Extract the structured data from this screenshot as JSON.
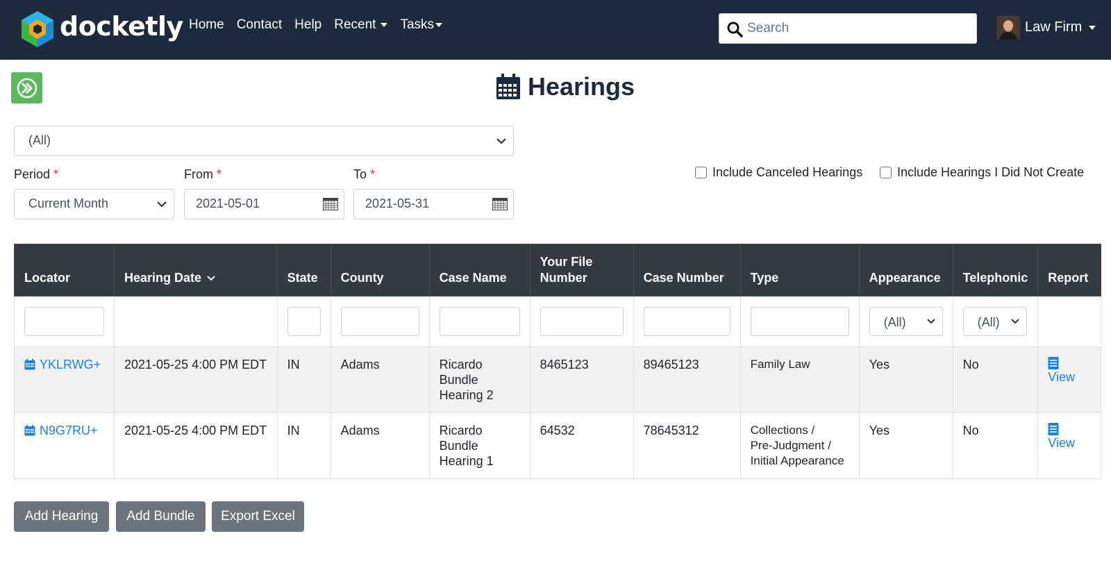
{
  "nav": {
    "brand": "docketly",
    "links": [
      "Home",
      "Contact",
      "Help",
      "Recent",
      "Tasks"
    ],
    "search_placeholder": "Search",
    "user": "Law Firm"
  },
  "page": {
    "title": "Hearings"
  },
  "filters": {
    "scope": "(All)",
    "period_label": "Period",
    "period_value": "Current Month",
    "from_label": "From",
    "from_value": "2021-05-01",
    "to_label": "To",
    "to_value": "2021-05-31",
    "required_mark": "*",
    "include_canceled": "Include Canceled Hearings",
    "include_not_created": "Include Hearings I Did Not Create"
  },
  "table": {
    "headers": [
      "Locator",
      "Hearing Date",
      "State",
      "County",
      "Case Name",
      "Your File Number",
      "Case Number",
      "Type",
      "Appearance",
      "Telephonic",
      "Report"
    ],
    "appearance_filter": "(All)",
    "telephonic_filter": "(All)",
    "rows": [
      {
        "locator": "YKLRWG+",
        "date": "2021-05-25 4:00 PM EDT",
        "state": "IN",
        "county": "Adams",
        "case_name": [
          "Ricardo",
          "Bundle",
          "Hearing 2"
        ],
        "file_number": "8465123",
        "case_number": "89465123",
        "type": [
          "Family Law"
        ],
        "appearance": "Yes",
        "telephonic": "No",
        "report": "View"
      },
      {
        "locator": "N9G7RU+",
        "date": "2021-05-25 4:00 PM EDT",
        "state": "IN",
        "county": "Adams",
        "case_name": [
          "Ricardo",
          "Bundle",
          "Hearing 1"
        ],
        "file_number": "64532",
        "case_number": "78645312",
        "type": [
          "Collections /",
          "Pre-Judgment /",
          "Initial Appearance"
        ],
        "appearance": "Yes",
        "telephonic": "No",
        "report": "View"
      }
    ]
  },
  "actions": {
    "add_hearing": "Add Hearing",
    "add_bundle": "Add Bundle",
    "export_excel": "Export Excel"
  },
  "colors": {
    "navbar": "#1c2a3c",
    "link": "#1a82e2",
    "go_button": "#5cb85c",
    "action_button": "#6c757d"
  }
}
